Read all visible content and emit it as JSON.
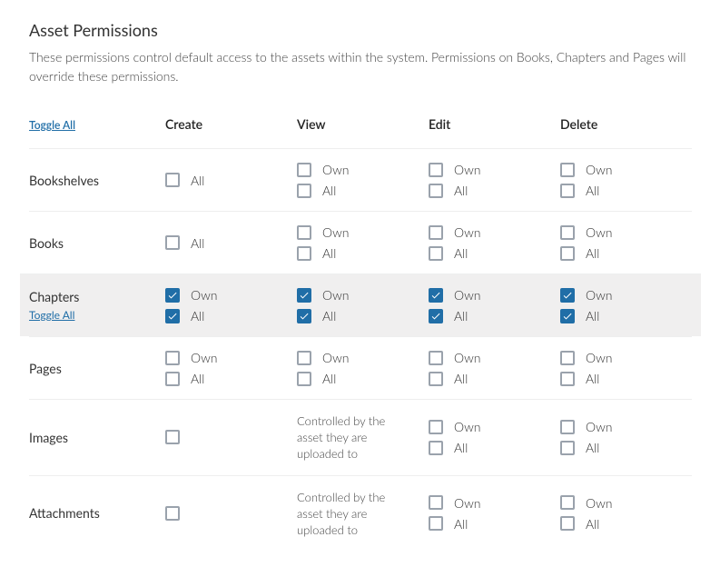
{
  "title": "Asset Permissions",
  "description": "These permissions control default access to the assets within the system. Permissions on Books, Chapters and Pages will override these permissions.",
  "toggle_all_label": "Toggle All",
  "columns": [
    "Create",
    "View",
    "Edit",
    "Delete"
  ],
  "option_own": "Own",
  "option_all": "All",
  "controlled_text": "Controlled by the asset they are uploaded to",
  "rows": [
    {
      "label": "Bookshelves",
      "show_toggle": false,
      "highlight": false,
      "cols": {
        "create": {
          "kind": "opts",
          "opts": [
            [
              "all",
              false
            ]
          ]
        },
        "view": {
          "kind": "opts",
          "opts": [
            [
              "own",
              false
            ],
            [
              "all",
              false
            ]
          ]
        },
        "edit": {
          "kind": "opts",
          "opts": [
            [
              "own",
              false
            ],
            [
              "all",
              false
            ]
          ]
        },
        "delete": {
          "kind": "opts",
          "opts": [
            [
              "own",
              false
            ],
            [
              "all",
              false
            ]
          ]
        }
      }
    },
    {
      "label": "Books",
      "show_toggle": false,
      "highlight": false,
      "cols": {
        "create": {
          "kind": "opts",
          "opts": [
            [
              "all",
              false
            ]
          ]
        },
        "view": {
          "kind": "opts",
          "opts": [
            [
              "own",
              false
            ],
            [
              "all",
              false
            ]
          ]
        },
        "edit": {
          "kind": "opts",
          "opts": [
            [
              "own",
              false
            ],
            [
              "all",
              false
            ]
          ]
        },
        "delete": {
          "kind": "opts",
          "opts": [
            [
              "own",
              false
            ],
            [
              "all",
              false
            ]
          ]
        }
      }
    },
    {
      "label": "Chapters",
      "show_toggle": true,
      "highlight": true,
      "cols": {
        "create": {
          "kind": "opts",
          "opts": [
            [
              "own",
              true
            ],
            [
              "all",
              true
            ]
          ]
        },
        "view": {
          "kind": "opts",
          "opts": [
            [
              "own",
              true
            ],
            [
              "all",
              true
            ]
          ]
        },
        "edit": {
          "kind": "opts",
          "opts": [
            [
              "own",
              true
            ],
            [
              "all",
              true
            ]
          ]
        },
        "delete": {
          "kind": "opts",
          "opts": [
            [
              "own",
              true
            ],
            [
              "all",
              true
            ]
          ]
        }
      }
    },
    {
      "label": "Pages",
      "show_toggle": false,
      "highlight": false,
      "cols": {
        "create": {
          "kind": "opts",
          "opts": [
            [
              "own",
              false
            ],
            [
              "all",
              false
            ]
          ]
        },
        "view": {
          "kind": "opts",
          "opts": [
            [
              "own",
              false
            ],
            [
              "all",
              false
            ]
          ]
        },
        "edit": {
          "kind": "opts",
          "opts": [
            [
              "own",
              false
            ],
            [
              "all",
              false
            ]
          ]
        },
        "delete": {
          "kind": "opts",
          "opts": [
            [
              "own",
              false
            ],
            [
              "all",
              false
            ]
          ]
        }
      }
    },
    {
      "label": "Images",
      "show_toggle": false,
      "highlight": false,
      "cols": {
        "create": {
          "kind": "opts",
          "opts": [
            [
              "blank",
              false
            ]
          ]
        },
        "view": {
          "kind": "controlled"
        },
        "edit": {
          "kind": "opts",
          "opts": [
            [
              "own",
              false
            ],
            [
              "all",
              false
            ]
          ]
        },
        "delete": {
          "kind": "opts",
          "opts": [
            [
              "own",
              false
            ],
            [
              "all",
              false
            ]
          ]
        }
      }
    },
    {
      "label": "Attachments",
      "show_toggle": false,
      "highlight": false,
      "cols": {
        "create": {
          "kind": "opts",
          "opts": [
            [
              "blank",
              false
            ]
          ]
        },
        "view": {
          "kind": "controlled"
        },
        "edit": {
          "kind": "opts",
          "opts": [
            [
              "own",
              false
            ],
            [
              "all",
              false
            ]
          ]
        },
        "delete": {
          "kind": "opts",
          "opts": [
            [
              "own",
              false
            ],
            [
              "all",
              false
            ]
          ]
        }
      }
    }
  ]
}
